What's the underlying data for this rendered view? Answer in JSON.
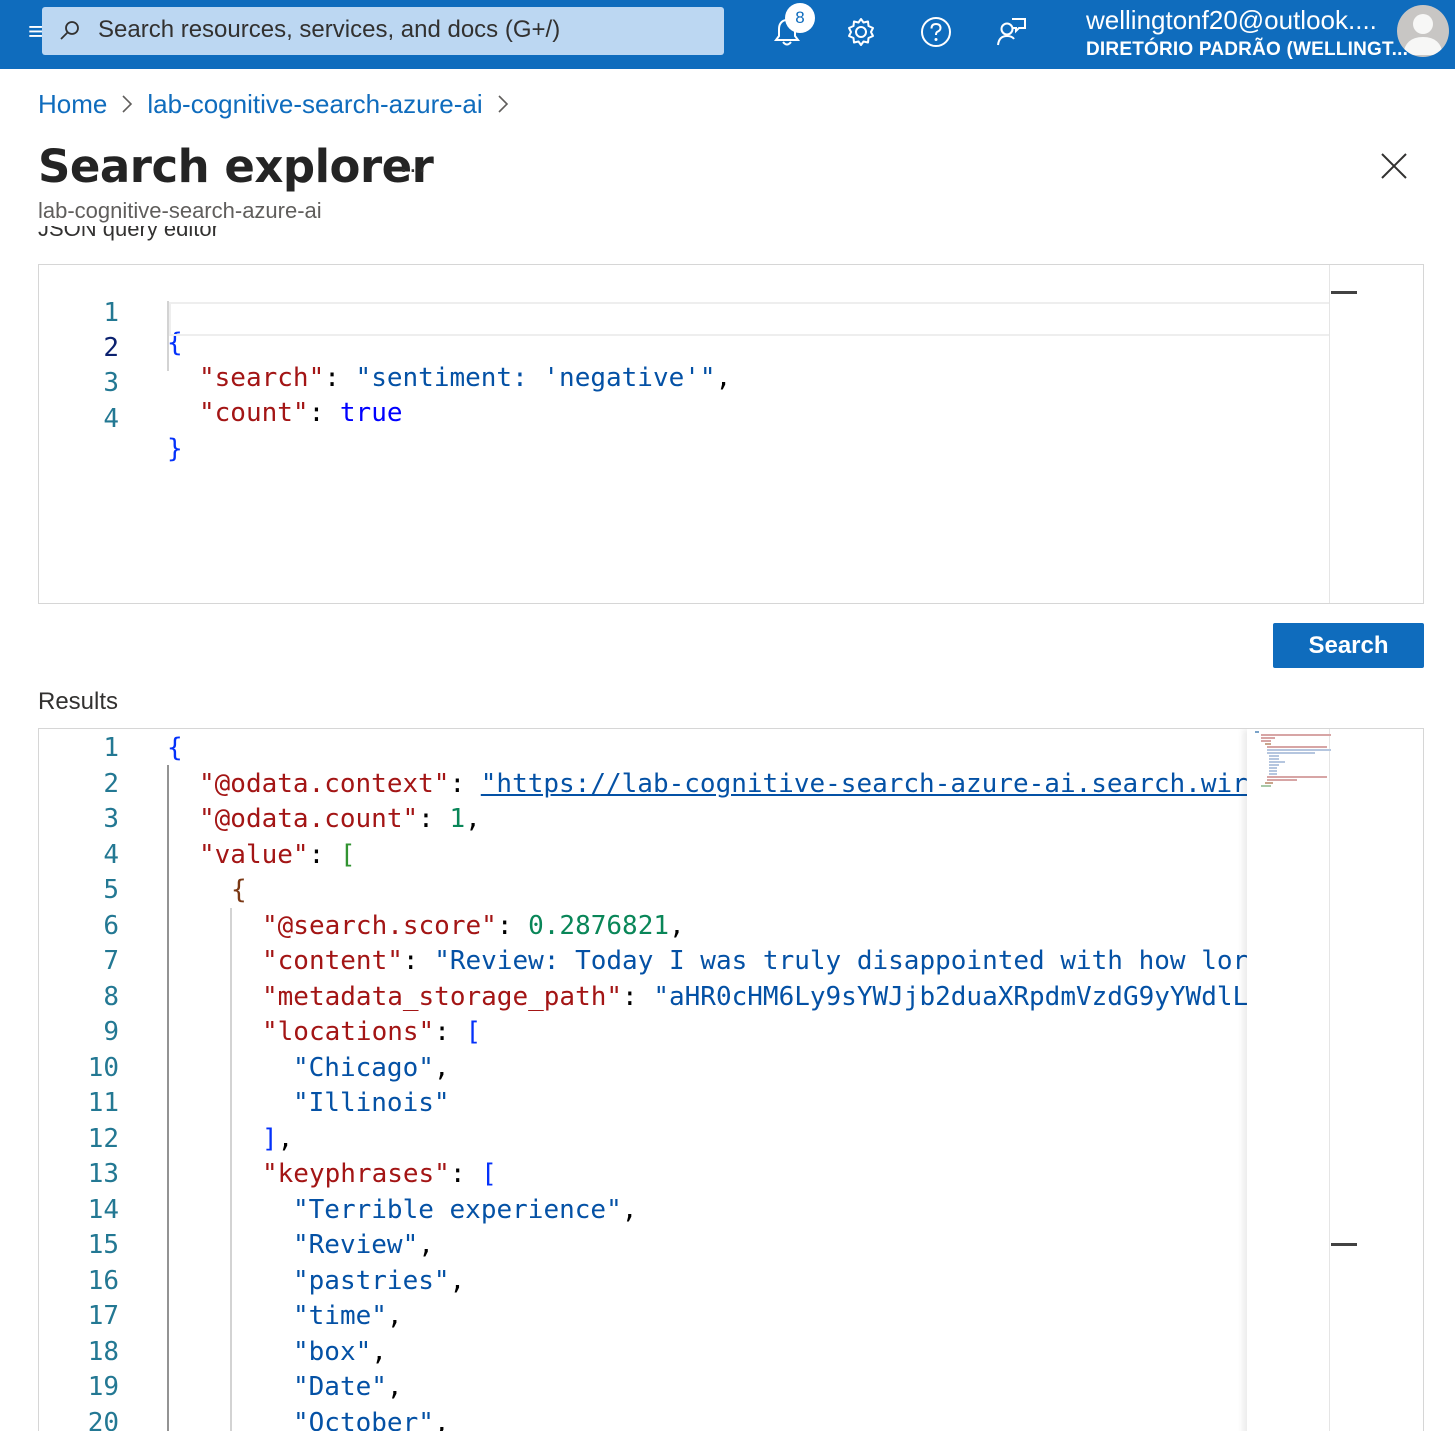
{
  "topbar": {
    "search_placeholder": "Search resources, services, and docs (G+/)",
    "notification_count": "8",
    "account_email": "wellingtonf20@outlook....",
    "account_directory": "DIRETÓRIO PADRÃO (WELLINGT..."
  },
  "breadcrumb": {
    "home": "Home",
    "resource": "lab-cognitive-search-azure-ai"
  },
  "page": {
    "title": "Search explorer",
    "more": "...",
    "subtitle": "lab-cognitive-search-azure-ai",
    "query_editor_label": "JSON query editor"
  },
  "query_editor": {
    "line_numbers": [
      "1",
      "2",
      "3",
      "4"
    ],
    "open_brace": "{",
    "search_key": "\"search\"",
    "search_value": "\"sentiment: 'negative'\"",
    "count_key": "\"count\"",
    "count_value": "true",
    "close_brace": "}"
  },
  "search_button": "Search",
  "results": {
    "label": "Results",
    "line_numbers": [
      "1",
      "2",
      "3",
      "4",
      "5",
      "6",
      "7",
      "8",
      "9",
      "10",
      "11",
      "12",
      "13",
      "14",
      "15",
      "16",
      "17",
      "18",
      "19",
      "20"
    ],
    "open_brace": "{",
    "odata_context_key": "\"@odata.context\"",
    "odata_context_value": "\"https://lab-cognitive-search-azure-ai.search.wir",
    "odata_count_key": "\"@odata.count\"",
    "odata_count_value": "1",
    "value_key": "\"value\"",
    "inner_open": "{",
    "score_key": "\"@search.score\"",
    "score_value": "0.2876821",
    "content_key": "\"content\"",
    "content_value": "\"Review: Today I was truly disappointed with how lor",
    "storage_key": "\"metadata_storage_path\"",
    "storage_value": "\"aHR0cHM6Ly9sYWJjb2duaXRpdmVzdG9yYWdlL",
    "locations_key": "\"locations\"",
    "locations": [
      "\"Chicago\"",
      "\"Illinois\""
    ],
    "keyphrases_key": "\"keyphrases\"",
    "keyphrases": [
      "\"Terrible experience\"",
      "\"Review\"",
      "\"pastries\"",
      "\"time\"",
      "\"box\"",
      "\"Date\"",
      "\"October\""
    ]
  }
}
